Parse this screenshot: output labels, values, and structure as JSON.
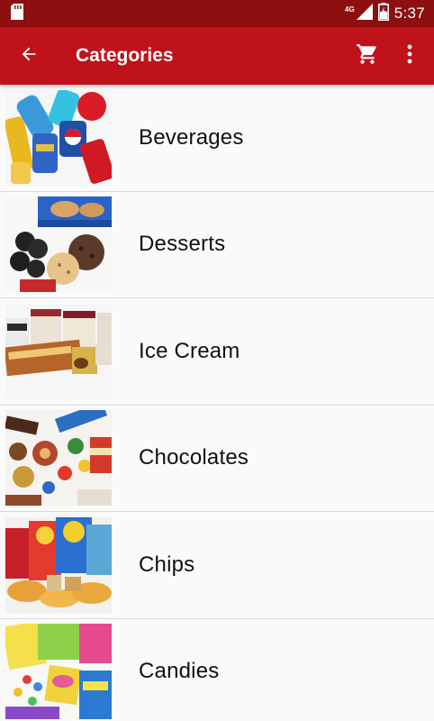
{
  "status_bar": {
    "time": "5:37",
    "network": "4G",
    "icons": [
      "sd-card-icon",
      "signal-icon",
      "battery-charging-icon"
    ]
  },
  "app_bar": {
    "title": "Categories",
    "back_icon": "arrow-back-icon",
    "cart_icon": "shopping-cart-icon",
    "more_icon": "more-vert-icon"
  },
  "colors": {
    "status_bar": "#8e0f0f",
    "app_bar": "#c0121a",
    "background": "#fafafa",
    "divider": "#d9d9d9"
  },
  "categories": [
    {
      "label": "Beverages"
    },
    {
      "label": "Desserts"
    },
    {
      "label": "Ice Cream"
    },
    {
      "label": "Chocolates"
    },
    {
      "label": "Chips"
    },
    {
      "label": "Candies"
    }
  ]
}
